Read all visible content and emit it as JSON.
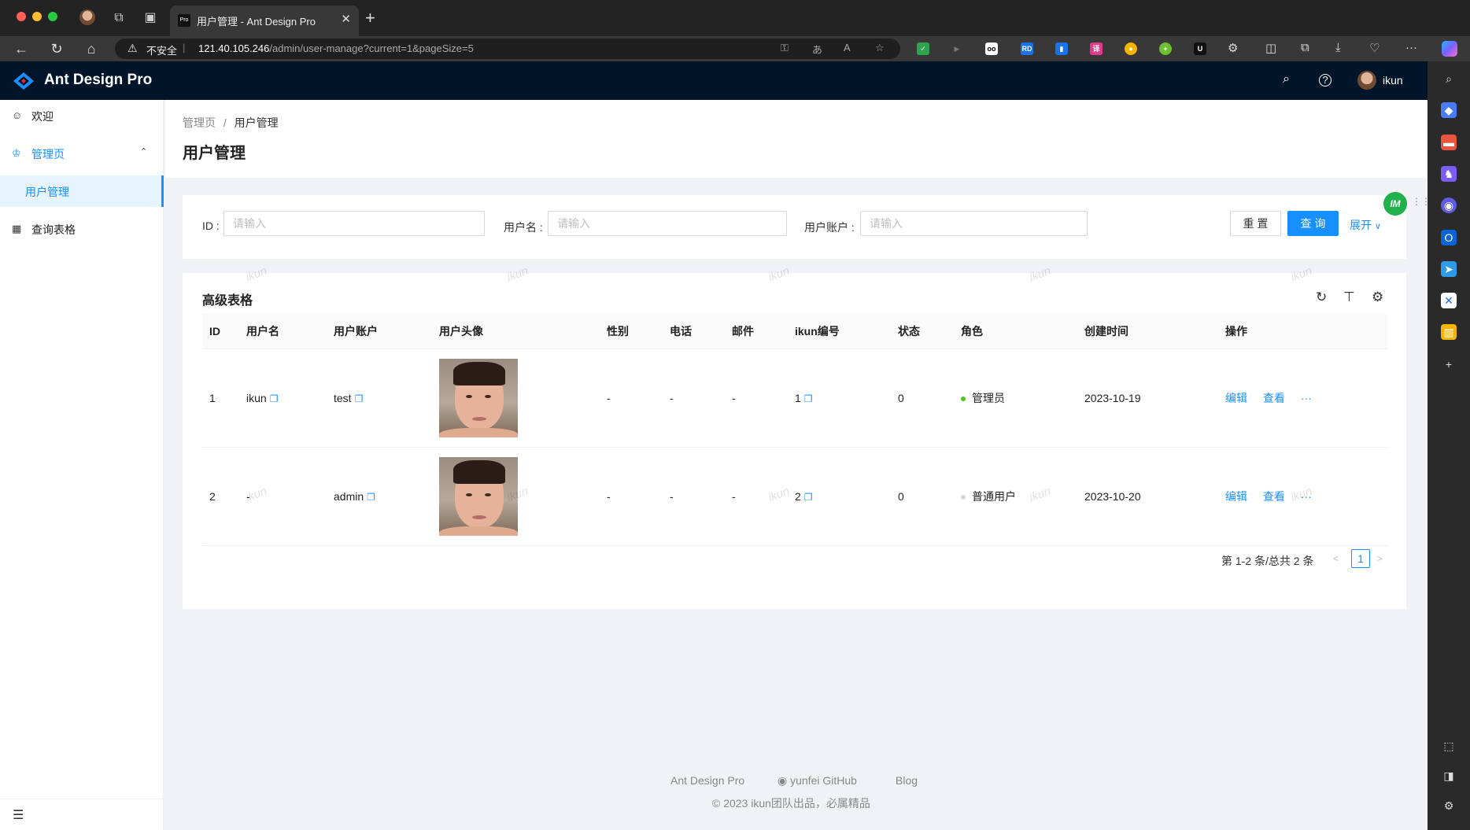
{
  "browser": {
    "tab_title": "用户管理 - Ant Design Pro",
    "tab_favicon": "Pro",
    "insecure_label": "不安全",
    "url_host": "121.40.105.246",
    "url_path": "/admin/user-manage?current=1&pageSize=5"
  },
  "app": {
    "title": "Ant Design Pro",
    "user_name": "ikun"
  },
  "sider": {
    "items": [
      {
        "label": "欢迎",
        "icon": "smile-icon"
      },
      {
        "label": "管理页",
        "icon": "crown-icon"
      },
      {
        "label": "用户管理"
      },
      {
        "label": "查询表格",
        "icon": "table-icon"
      }
    ]
  },
  "breadcrumb": {
    "root": "管理页",
    "sep": "/",
    "current": "用户管理"
  },
  "page_title": "用户管理",
  "search": {
    "fields": [
      {
        "label": "ID :",
        "placeholder": "请输入"
      },
      {
        "label": "用户名 :",
        "placeholder": "请输入"
      },
      {
        "label": "用户账户 :",
        "placeholder": "请输入"
      }
    ],
    "reset_label": "重 置",
    "query_label": "查 询",
    "expand_label": "展开"
  },
  "im_badge": "IM",
  "table": {
    "title": "高级表格",
    "columns": [
      "ID",
      "用户名",
      "用户账户",
      "用户头像",
      "性别",
      "电话",
      "邮件",
      "ikun编号",
      "状态",
      "角色",
      "创建时间",
      "操作"
    ],
    "rows": [
      {
        "id": "1",
        "username": "ikun",
        "account": "test",
        "gender": "-",
        "phone": "-",
        "email": "-",
        "ikun_no": "1",
        "status": "0",
        "role": "管理员",
        "role_color": "#52c41a",
        "created": "2023-10-19",
        "edit": "编辑",
        "view": "查看",
        "more": "···"
      },
      {
        "id": "2",
        "username": "-",
        "account": "admin",
        "gender": "-",
        "phone": "-",
        "email": "-",
        "ikun_no": "2",
        "status": "0",
        "role": "普通用户",
        "role_color": "#d9d9d9",
        "created": "2023-10-20",
        "edit": "编辑",
        "view": "查看",
        "more": "···"
      }
    ],
    "pagination": {
      "summary": "第 1-2 条/总共 2 条",
      "current_page": "1"
    }
  },
  "watermark_text": "ikun",
  "footer": {
    "links": [
      "Ant Design Pro",
      "yunfei GitHub",
      "Blog"
    ],
    "copyright": "2023 ikun团队出品，必属精品"
  },
  "colors": {
    "primary": "#1890ff",
    "header_bg": "#001529",
    "page_bg": "#f0f2f5"
  }
}
